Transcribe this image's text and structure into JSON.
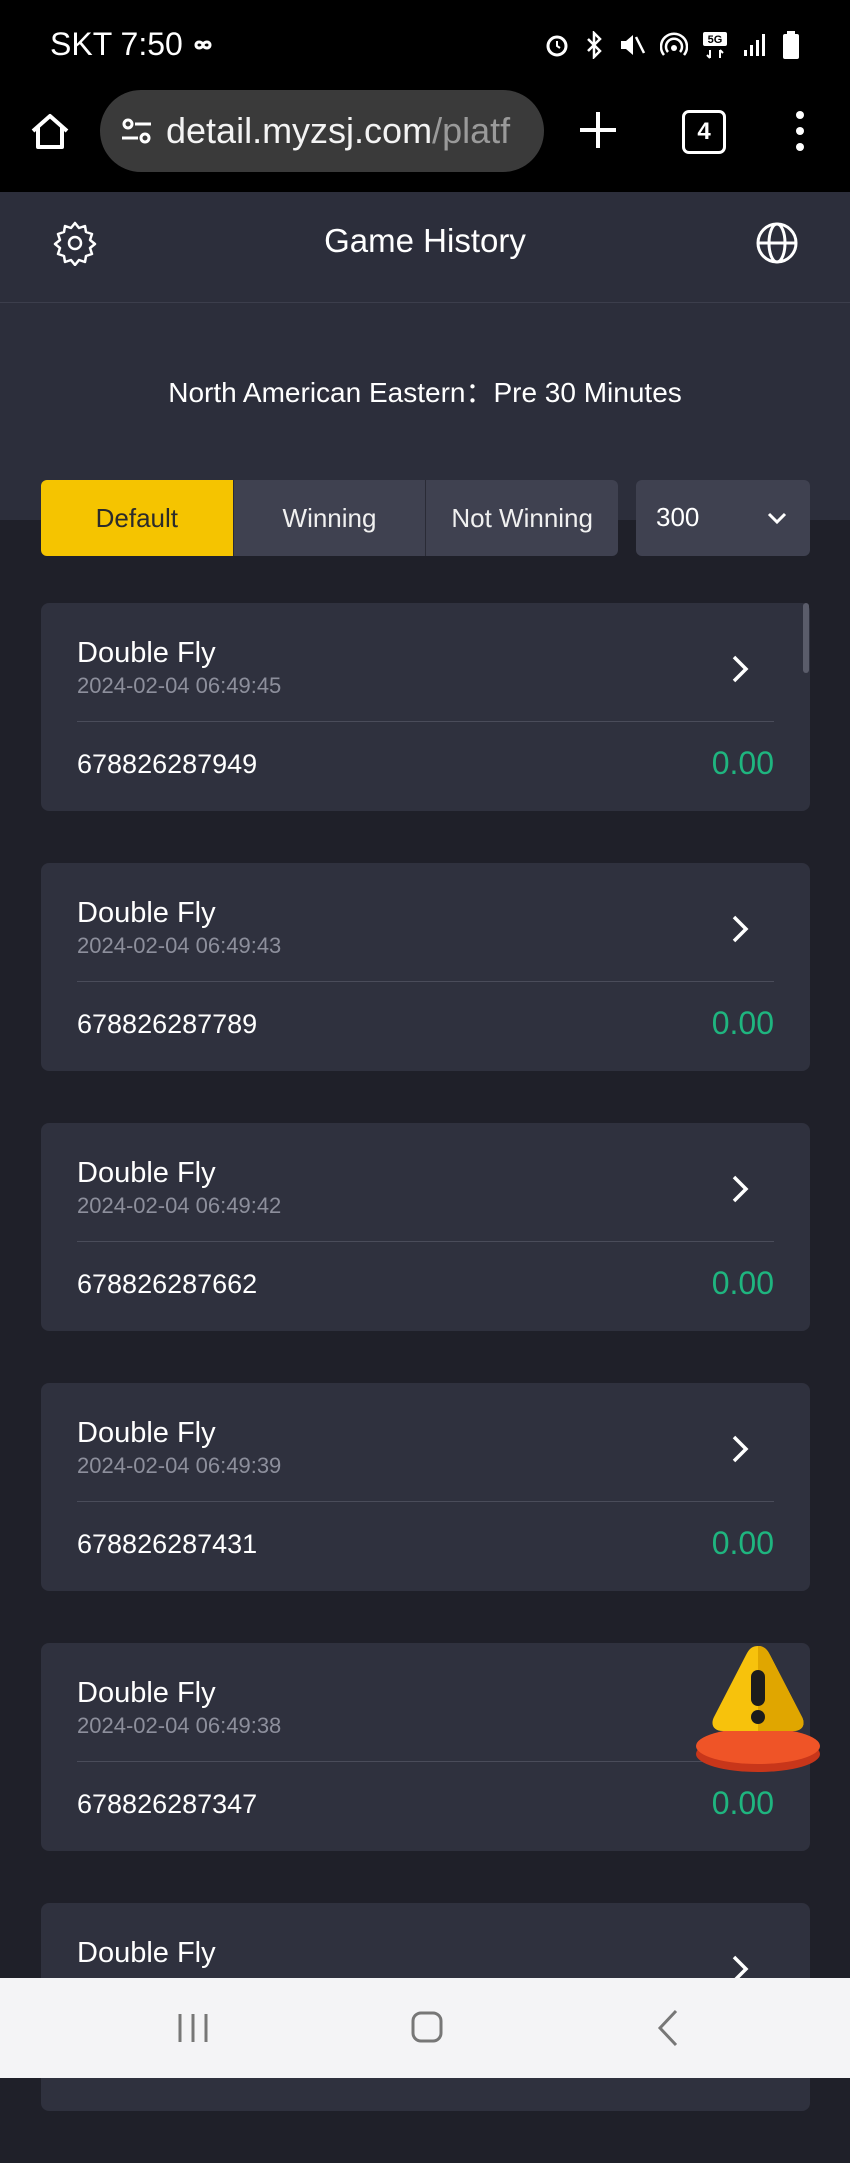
{
  "status_bar": {
    "time": "SKT 7:50",
    "icons": [
      "infinity-icon",
      "alarm-icon",
      "bluetooth-icon",
      "mute-icon",
      "hotspot-icon",
      "5g-icon",
      "signal-icon",
      "battery-icon"
    ]
  },
  "browser": {
    "url_host": "detail.myzsj.com",
    "url_path": "/platf",
    "tab_count": "4"
  },
  "header": {
    "title": "Game History"
  },
  "timezone": "North American Eastern：Pre 30 Minutes",
  "filters": {
    "tabs": [
      {
        "label": "Default",
        "active": true
      },
      {
        "label": "Winning",
        "active": false
      },
      {
        "label": "Not Winning",
        "active": false
      }
    ],
    "count_select": "300"
  },
  "records": [
    {
      "game": "Double Fly",
      "time": "2024-02-04 06:49:45",
      "id": "678826287949",
      "amount": "0.00"
    },
    {
      "game": "Double Fly",
      "time": "2024-02-04 06:49:43",
      "id": "678826287789",
      "amount": "0.00"
    },
    {
      "game": "Double Fly",
      "time": "2024-02-04 06:49:42",
      "id": "678826287662",
      "amount": "0.00"
    },
    {
      "game": "Double Fly",
      "time": "2024-02-04 06:49:39",
      "id": "678826287431",
      "amount": "0.00"
    },
    {
      "game": "Double Fly",
      "time": "2024-02-04 06:49:38",
      "id": "678826287347",
      "amount": "0.00"
    },
    {
      "game": "Double Fly",
      "time": "",
      "id": "",
      "amount": ""
    }
  ],
  "colors": {
    "accent": "#f5c400",
    "amount": "#1fb57f",
    "card": "#2f313e",
    "background": "#1f2029"
  }
}
